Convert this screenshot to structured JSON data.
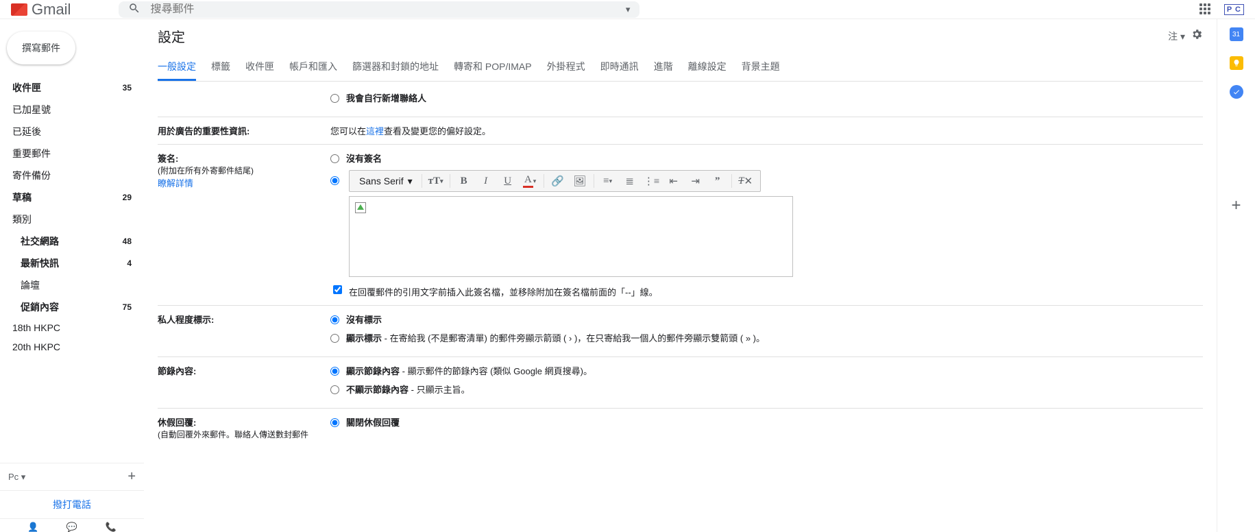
{
  "header": {
    "logo_text": "Gmail",
    "search_placeholder": "搜尋郵件",
    "pc_badge": "P C"
  },
  "sidebar": {
    "compose": "撰寫郵件",
    "items": [
      {
        "label": "收件匣",
        "count": "35",
        "bold": true
      },
      {
        "label": "已加星號",
        "count": ""
      },
      {
        "label": "已延後",
        "count": ""
      },
      {
        "label": "重要郵件",
        "count": ""
      },
      {
        "label": "寄件備份",
        "count": ""
      },
      {
        "label": "草稿",
        "count": "29",
        "bold": true
      },
      {
        "label": "類別",
        "count": ""
      }
    ],
    "categories": [
      {
        "label": "社交網路",
        "count": "48"
      },
      {
        "label": "最新快訊",
        "count": "4"
      },
      {
        "label": "論壇",
        "count": ""
      },
      {
        "label": "促銷內容",
        "count": "75"
      }
    ],
    "user_labels": [
      {
        "label": "18th HKPC"
      },
      {
        "label": "20th HKPC"
      }
    ],
    "hangouts_name": "Pc",
    "dial": "撥打電話"
  },
  "settings": {
    "title": "設定",
    "density_label": "注",
    "tabs": [
      "一般設定",
      "標籤",
      "收件匣",
      "帳戶和匯入",
      "篩選器和封鎖的地址",
      "轉寄和 POP/IMAP",
      "外掛程式",
      "即時通訊",
      "進階",
      "離線設定",
      "背景主題"
    ],
    "active_tab": 0,
    "contacts_option": "我會自行新增聯絡人",
    "ads_label": "用於廣告的重要性資訊:",
    "ads_text_pre": "您可以在",
    "ads_link": "這裡",
    "ads_text_post": "查看及變更您的偏好設定。",
    "signature": {
      "label": "簽名:",
      "sub": "(附加在所有外寄郵件結尾)",
      "learn_more": "瞭解詳情",
      "opt_none": "沒有簽名",
      "font": "Sans Serif",
      "checkbox_text": "在回覆郵件的引用文字前插入此簽名檔，並移除附加在簽名檔前面的「--」線。"
    },
    "indicators": {
      "label": "私人程度標示:",
      "opt_none": "沒有標示",
      "opt_show_bold": "顯示標示",
      "opt_show_rest": " - 在寄給我 (不是郵寄清單) 的郵件旁顯示箭頭 ( › )，在只寄給我一個人的郵件旁顯示雙箭頭 ( » )。"
    },
    "snippets": {
      "label": "節錄內容:",
      "opt_show_bold": "顯示節錄內容",
      "opt_show_rest": " - 顯示郵件的節錄內容 (類似 Google 網頁搜尋)。",
      "opt_hide_bold": "不顯示節錄內容",
      "opt_hide_rest": " - 只顯示主旨。"
    },
    "vacation": {
      "label": "休假回覆:",
      "sub": "(自動回覆外來郵件。聯絡人傳送數封郵件",
      "opt_off": "關閉休假回覆"
    }
  },
  "right_rail": {
    "cal_day": "31"
  }
}
